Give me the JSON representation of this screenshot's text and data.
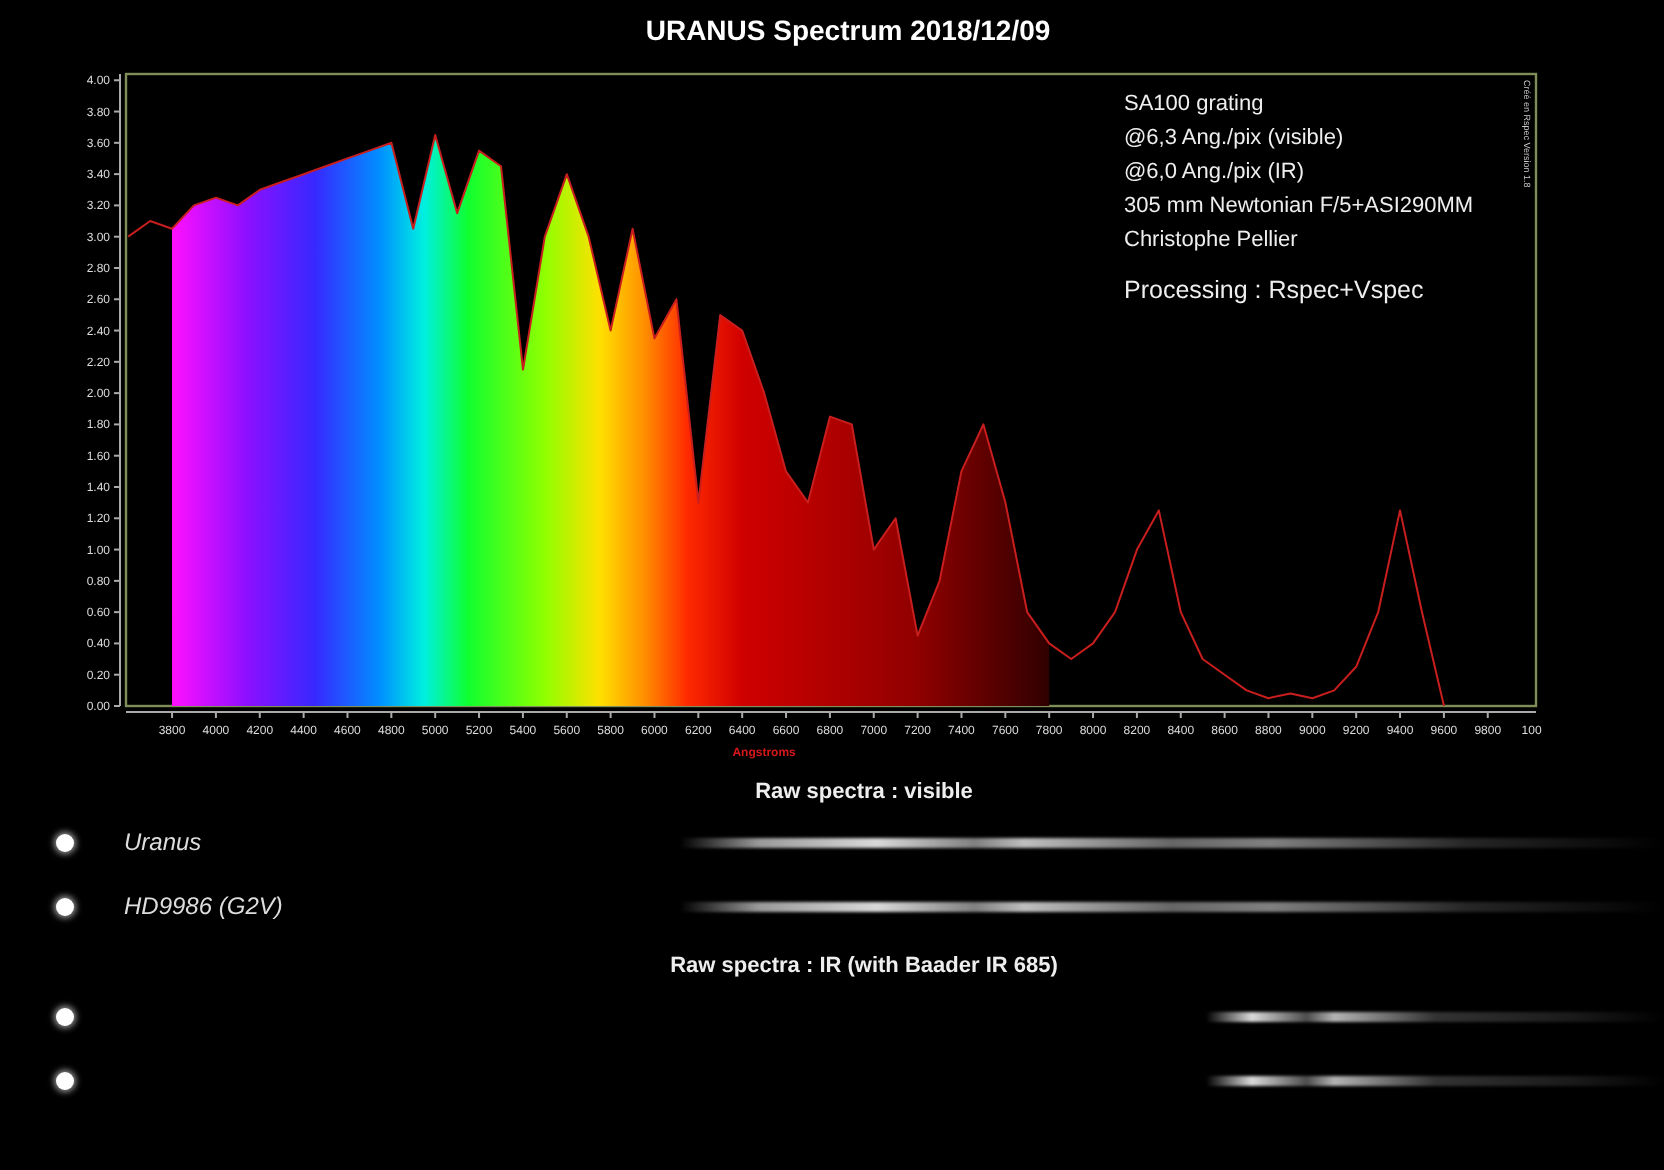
{
  "chart": {
    "credit": "Créé en Rspec Version 1.8",
    "chart_data": {
      "type": "line",
      "title": "URANUS Spectrum 2018/12/09",
      "xlabel": "Angstroms",
      "x": [
        3600,
        3700,
        3800,
        3900,
        4000,
        4100,
        4200,
        4300,
        4400,
        4500,
        4600,
        4700,
        4800,
        4900,
        5000,
        5100,
        5200,
        5300,
        5400,
        5500,
        5600,
        5700,
        5800,
        5900,
        6000,
        6100,
        6200,
        6300,
        6400,
        6500,
        6600,
        6700,
        6800,
        6900,
        7000,
        7100,
        7200,
        7300,
        7400,
        7500,
        7600,
        7700,
        7800,
        7900,
        8000,
        8100,
        8200,
        8300,
        8400,
        8500,
        8600,
        8700,
        8800,
        8900,
        9000,
        9100,
        9200,
        9300,
        9400,
        9500,
        9600
      ],
      "series": [
        {
          "color": "#c81e1e",
          "values": [
            3.0,
            3.1,
            3.05,
            3.2,
            3.25,
            3.2,
            3.3,
            3.35,
            3.4,
            3.45,
            3.5,
            3.55,
            3.6,
            3.05,
            3.65,
            3.15,
            3.55,
            3.45,
            2.15,
            3.0,
            3.4,
            3.0,
            2.4,
            3.05,
            2.35,
            2.6,
            1.3,
            2.5,
            2.4,
            2.0,
            1.5,
            1.3,
            1.85,
            1.8,
            1.0,
            1.2,
            0.45,
            0.8,
            1.5,
            1.8,
            1.3,
            0.6,
            0.4,
            0.3,
            0.4,
            0.6,
            1.0,
            1.25,
            0.6,
            0.3,
            0.2,
            0.1,
            0.05,
            0.08,
            0.05,
            0.1,
            0.25,
            0.6,
            1.25,
            0.6,
            0.0
          ]
        }
      ],
      "xlim": [
        3590,
        10020
      ],
      "ylim": [
        0,
        4.04
      ],
      "xticks": [
        3800,
        4000,
        4200,
        4400,
        4600,
        4800,
        5000,
        5200,
        5400,
        5600,
        5800,
        6000,
        6200,
        6400,
        6600,
        6800,
        7000,
        7200,
        7400,
        7600,
        7800,
        8000,
        8200,
        8400,
        8600,
        8800,
        9000,
        9200,
        9400,
        9600,
        9800
      ],
      "yticks": [
        {
          "value": 0,
          "label": "0.00"
        },
        {
          "value": 0.2,
          "label": "0.20"
        },
        {
          "value": 0.4,
          "label": "0.40"
        },
        {
          "value": 0.6,
          "label": "0.60"
        },
        {
          "value": 0.8,
          "label": "0.80"
        },
        {
          "value": 1,
          "label": "1.00"
        },
        {
          "value": 1.2,
          "label": "1.20"
        },
        {
          "value": 1.4,
          "label": "1.40"
        },
        {
          "value": 1.6,
          "label": "1.60"
        },
        {
          "value": 1.8,
          "label": "1.80"
        },
        {
          "value": 2,
          "label": "2.00"
        },
        {
          "value": 2.2,
          "label": "2.20"
        },
        {
          "value": 2.4,
          "label": "2.40"
        },
        {
          "value": 2.6,
          "label": "2.60"
        },
        {
          "value": 2.8,
          "label": "2.80"
        },
        {
          "value": 3,
          "label": "3.00"
        },
        {
          "value": 3.2,
          "label": "3.20"
        },
        {
          "value": 3.4,
          "label": "3.40"
        },
        {
          "value": 3.6,
          "label": "3.60"
        },
        {
          "value": 3.8,
          "label": "3.80"
        },
        {
          "value": 4,
          "label": "4.00"
        }
      ]
    },
    "x_edge_label": "100",
    "notes": [
      {
        "kind": "note",
        "text": "SA100 grating"
      },
      {
        "kind": "note",
        "text": "@6,3 Ang./pix (visible)"
      },
      {
        "kind": "note",
        "text": "@6,0 Ang./pix (IR)"
      },
      {
        "kind": "note",
        "text": "305 mm Newtonian F/5+ASI290MM"
      },
      {
        "kind": "note",
        "text": "Christophe Pellier"
      },
      {
        "kind": "emphasis",
        "text": "Processing : Rspec+Vspec"
      }
    ]
  },
  "raw_sections": [
    {
      "kind": "visible",
      "title": "Raw spectra : visible",
      "rows": [
        {
          "label": "Uranus"
        },
        {
          "label": "HD9986 (G2V)"
        }
      ]
    },
    {
      "kind": "ir",
      "title": "Raw spectra : IR (with Baader IR 685)",
      "rows": [
        {},
        {}
      ]
    }
  ]
}
